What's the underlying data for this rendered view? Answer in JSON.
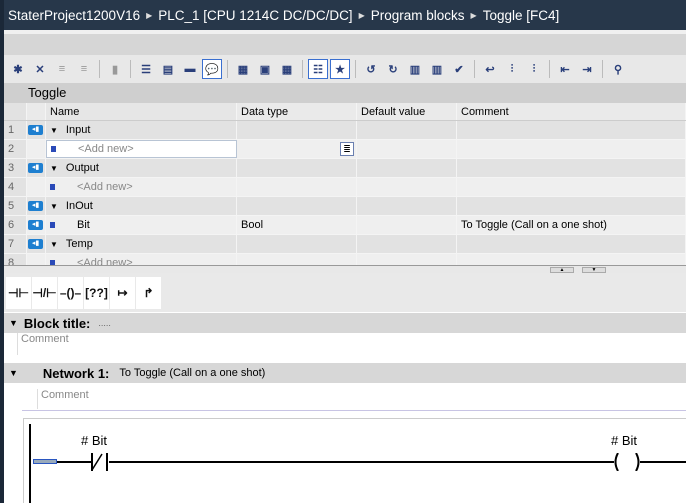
{
  "breadcrumb": [
    "StaterProject1200V16",
    "PLC_1 [CPU 1214C DC/DC/DC]",
    "Program blocks",
    "Toggle [FC4]"
  ],
  "toolbar_icons": [
    "insert-row",
    "delete-row",
    "add-row-disabled",
    "remove-row-disabled",
    "|",
    "block-disabled",
    "|",
    "collapse-all",
    "split-view",
    "show-list",
    "comment-view",
    "|",
    "interface-download",
    "monitor-download",
    "tag-download",
    "|",
    "absolute-ops",
    "favorites",
    "|",
    "go-error-prev",
    "go-error-next",
    "module-ref",
    "module-ref-2",
    "compile-check",
    "|",
    "jump-prev",
    "jump-up",
    "jump-down",
    "|",
    "go-first",
    "go-last",
    "|",
    "find"
  ],
  "block_name": "Toggle",
  "table": {
    "headers": [
      "Name",
      "Data type",
      "Default value",
      "Comment"
    ],
    "rows": [
      {
        "n": "1",
        "kind": "section",
        "name": "Input",
        "type": "",
        "def": "",
        "comment": ""
      },
      {
        "n": "2",
        "kind": "add",
        "name": "<Add new>",
        "type": "",
        "def": "",
        "comment": "",
        "active": true
      },
      {
        "n": "3",
        "kind": "section",
        "name": "Output",
        "type": "",
        "def": "",
        "comment": ""
      },
      {
        "n": "4",
        "kind": "add",
        "name": "<Add new>",
        "type": "",
        "def": "",
        "comment": ""
      },
      {
        "n": "5",
        "kind": "section",
        "name": "InOut",
        "type": "",
        "def": "",
        "comment": ""
      },
      {
        "n": "6",
        "kind": "var",
        "name": "Bit",
        "type": "Bool",
        "def": "",
        "comment": "To Toggle (Call on a one shot)"
      },
      {
        "n": "7",
        "kind": "section",
        "name": "Temp",
        "type": "",
        "def": "",
        "comment": ""
      },
      {
        "n": "8",
        "kind": "add",
        "name": "<Add new>",
        "type": "",
        "def": "",
        "comment": ""
      }
    ]
  },
  "instructions": [
    {
      "name": "no-contact",
      "glyph": "⊣⊢"
    },
    {
      "name": "nc-contact",
      "glyph": "⊣/⊢"
    },
    {
      "name": "coil",
      "glyph": "–()–"
    },
    {
      "name": "empty-box",
      "glyph": "[??]"
    },
    {
      "name": "open-branch",
      "glyph": "↦"
    },
    {
      "name": "close-branch",
      "glyph": "↱"
    }
  ],
  "block_title": {
    "label": "Block title:",
    "value": ".....",
    "comment": "Comment"
  },
  "network": {
    "label": "Network 1:",
    "title": "To Toggle (Call on a one shot)",
    "comment": "Comment",
    "contact_tag": "# Bit",
    "coil_tag": "# Bit"
  }
}
